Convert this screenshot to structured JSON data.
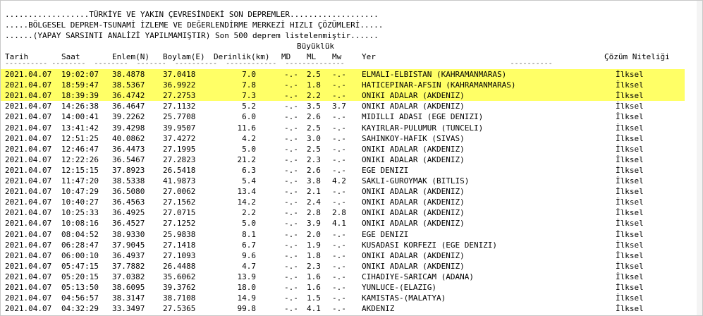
{
  "header_lines": [
    "..................TÜRKİYE VE YAKIN ÇEVRESİNDEKİ SON DEPREMLER...................",
    ".....BÖLGESEL DEPREM-TSUNAMİ İZLEME VE DEĞERLENDİRME MERKEZİ HIZLI ÇÖZÜMLERİ.....",
    "......(YAPAY SARSINTI ANALİZİ YAPILMAMIŞTIR) Son 500 deprem listelenmiştir......"
  ],
  "buyukluk_label": "Büyüklük",
  "columns": {
    "tarih": "Tarih",
    "saat": "Saat",
    "enlem": "Enlem(N)",
    "boylam": "Boylam(E)",
    "derinlik": "Derinlik(km)",
    "md": "MD",
    "ml": "ML",
    "mw": "Mw",
    "yer": "Yer",
    "cozum": "Çözüm Niteliği"
  },
  "separator": "---------- --------  --------  -------  ----------  ------------  --------------                                       ----------",
  "rows": [
    {
      "tarih": "2021.04.07",
      "saat": "19:02:07",
      "enlem": "38.4878",
      "boylam": "37.0418",
      "derinlik": "7.0",
      "md": "-.-",
      "ml": "2.5",
      "mw": "-.-",
      "yer": "ELMALI-ELBISTAN (KAHRAMANMARAS)",
      "cozum": "İlksel"
    },
    {
      "tarih": "2021.04.07",
      "saat": "18:59:47",
      "enlem": "38.5367",
      "boylam": "36.9922",
      "derinlik": "7.8",
      "md": "-.-",
      "ml": "1.8",
      "mw": "-.-",
      "yer": "HATICEPINAR-AFSIN (KAHRAMANMARAS)",
      "cozum": "İlksel"
    },
    {
      "tarih": "2021.04.07",
      "saat": "18:39:39",
      "enlem": "36.4742",
      "boylam": "27.2753",
      "derinlik": "7.3",
      "md": "-.-",
      "ml": "2.2",
      "mw": "-.-",
      "yer": "ONIKI ADALAR (AKDENIZ)",
      "cozum": "İlksel"
    },
    {
      "tarih": "2021.04.07",
      "saat": "14:26:38",
      "enlem": "36.4647",
      "boylam": "27.1132",
      "derinlik": "5.2",
      "md": "-.-",
      "ml": "3.5",
      "mw": "3.7",
      "yer": "ONIKI ADALAR (AKDENIZ)",
      "cozum": "İlksel"
    },
    {
      "tarih": "2021.04.07",
      "saat": "14:00:41",
      "enlem": "39.2262",
      "boylam": "25.7708",
      "derinlik": "6.0",
      "md": "-.-",
      "ml": "2.6",
      "mw": "-.-",
      "yer": "MIDILLI ADASI (EGE DENIZI)",
      "cozum": "İlksel"
    },
    {
      "tarih": "2021.04.07",
      "saat": "13:41:42",
      "enlem": "39.4298",
      "boylam": "39.9507",
      "derinlik": "11.6",
      "md": "-.-",
      "ml": "2.5",
      "mw": "-.-",
      "yer": "KAYIRLAR-PULUMUR (TUNCELI)",
      "cozum": "İlksel"
    },
    {
      "tarih": "2021.04.07",
      "saat": "12:51:25",
      "enlem": "40.0862",
      "boylam": "37.4272",
      "derinlik": "4.2",
      "md": "-.-",
      "ml": "3.0",
      "mw": "-.-",
      "yer": "SAHINKOY-HAFIK (SIVAS)",
      "cozum": "İlksel"
    },
    {
      "tarih": "2021.04.07",
      "saat": "12:46:47",
      "enlem": "36.4473",
      "boylam": "27.1995",
      "derinlik": "5.0",
      "md": "-.-",
      "ml": "2.5",
      "mw": "-.-",
      "yer": "ONIKI ADALAR (AKDENIZ)",
      "cozum": "İlksel"
    },
    {
      "tarih": "2021.04.07",
      "saat": "12:22:26",
      "enlem": "36.5467",
      "boylam": "27.2823",
      "derinlik": "21.2",
      "md": "-.-",
      "ml": "2.3",
      "mw": "-.-",
      "yer": "ONIKI ADALAR (AKDENIZ)",
      "cozum": "İlksel"
    },
    {
      "tarih": "2021.04.07",
      "saat": "12:15:15",
      "enlem": "37.8923",
      "boylam": "26.5418",
      "derinlik": "6.3",
      "md": "-.-",
      "ml": "2.6",
      "mw": "-.-",
      "yer": "EGE DENIZI",
      "cozum": "İlksel"
    },
    {
      "tarih": "2021.04.07",
      "saat": "11:47:20",
      "enlem": "38.5338",
      "boylam": "41.9873",
      "derinlik": "5.4",
      "md": "-.-",
      "ml": "3.8",
      "mw": "4.2",
      "yer": "SAKLI-GUROYMAK (BITLIS)",
      "cozum": "İlksel"
    },
    {
      "tarih": "2021.04.07",
      "saat": "10:47:29",
      "enlem": "36.5080",
      "boylam": "27.0062",
      "derinlik": "13.4",
      "md": "-.-",
      "ml": "2.1",
      "mw": "-.-",
      "yer": "ONIKI ADALAR (AKDENIZ)",
      "cozum": "İlksel"
    },
    {
      "tarih": "2021.04.07",
      "saat": "10:40:27",
      "enlem": "36.4563",
      "boylam": "27.1562",
      "derinlik": "14.2",
      "md": "-.-",
      "ml": "2.4",
      "mw": "-.-",
      "yer": "ONIKI ADALAR (AKDENIZ)",
      "cozum": "İlksel"
    },
    {
      "tarih": "2021.04.07",
      "saat": "10:25:33",
      "enlem": "36.4925",
      "boylam": "27.0715",
      "derinlik": "2.2",
      "md": "-.-",
      "ml": "2.8",
      "mw": "2.8",
      "yer": "ONIKI ADALAR (AKDENIZ)",
      "cozum": "İlksel"
    },
    {
      "tarih": "2021.04.07",
      "saat": "10:08:16",
      "enlem": "36.4527",
      "boylam": "27.1252",
      "derinlik": "5.0",
      "md": "-.-",
      "ml": "3.9",
      "mw": "4.1",
      "yer": "ONIKI ADALAR (AKDENIZ)",
      "cozum": "İlksel"
    },
    {
      "tarih": "2021.04.07",
      "saat": "08:04:52",
      "enlem": "38.9330",
      "boylam": "25.9838",
      "derinlik": "8.1",
      "md": "-.-",
      "ml": "2.0",
      "mw": "-.-",
      "yer": "EGE DENIZI",
      "cozum": "İlksel"
    },
    {
      "tarih": "2021.04.07",
      "saat": "06:28:47",
      "enlem": "37.9045",
      "boylam": "27.1418",
      "derinlik": "6.7",
      "md": "-.-",
      "ml": "1.9",
      "mw": "-.-",
      "yer": "KUSADASI KORFEZI (EGE DENIZI)",
      "cozum": "İlksel"
    },
    {
      "tarih": "2021.04.07",
      "saat": "06:00:10",
      "enlem": "36.4937",
      "boylam": "27.1093",
      "derinlik": "9.6",
      "md": "-.-",
      "ml": "1.8",
      "mw": "-.-",
      "yer": "ONIKI ADALAR (AKDENIZ)",
      "cozum": "İlksel"
    },
    {
      "tarih": "2021.04.07",
      "saat": "05:47:15",
      "enlem": "37.7882",
      "boylam": "26.4488",
      "derinlik": "4.7",
      "md": "-.-",
      "ml": "2.3",
      "mw": "-.-",
      "yer": "ONIKI ADALAR (AKDENIZ)",
      "cozum": "İlksel"
    },
    {
      "tarih": "2021.04.07",
      "saat": "05:20:15",
      "enlem": "37.0382",
      "boylam": "35.6062",
      "derinlik": "13.9",
      "md": "-.-",
      "ml": "1.6",
      "mw": "-.-",
      "yer": "CIHADIYE-SARICAM (ADANA)",
      "cozum": "İlksel"
    },
    {
      "tarih": "2021.04.07",
      "saat": "05:13:50",
      "enlem": "38.6095",
      "boylam": "39.3762",
      "derinlik": "18.0",
      "md": "-.-",
      "ml": "1.6",
      "mw": "-.-",
      "yer": "YUNLUCE-(ELAZIG)",
      "cozum": "İlksel"
    },
    {
      "tarih": "2021.04.07",
      "saat": "04:56:57",
      "enlem": "38.3147",
      "boylam": "38.7108",
      "derinlik": "14.9",
      "md": "-.-",
      "ml": "1.5",
      "mw": "-.-",
      "yer": "KAMISTAS-(MALATYA)",
      "cozum": "İlksel"
    },
    {
      "tarih": "2021.04.07",
      "saat": "04:32:29",
      "enlem": "33.3497",
      "boylam": "27.5365",
      "derinlik": "99.8",
      "md": "-.-",
      "ml": "4.1",
      "mw": "-.-",
      "yer": "AKDENIZ",
      "cozum": "İlksel"
    }
  ],
  "highlight_color": "#ffff66"
}
